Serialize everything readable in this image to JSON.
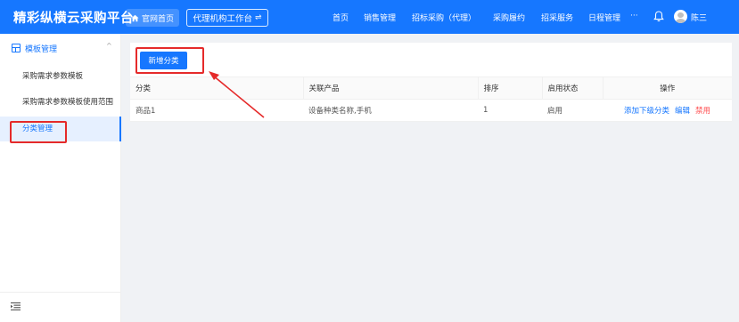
{
  "header": {
    "brand": "精彩纵横云采购平台",
    "home_button": "官网首页",
    "agent_button": "代理机构工作台",
    "agent_swap_icon": "⇌",
    "nav": [
      "首页",
      "销售管理",
      "招标采购（代理）",
      "采购履约",
      "招采服务",
      "日程管理"
    ],
    "more": "···",
    "username": "陈三"
  },
  "sidebar": {
    "group_label": "模板管理",
    "caret": "^",
    "items": [
      {
        "label": "采购需求参数模板"
      },
      {
        "label": "采购需求参数模板使用范围"
      },
      {
        "label": "分类管理"
      }
    ]
  },
  "main": {
    "add_button": "新增分类",
    "columns": [
      "分类",
      "关联产品",
      "排序",
      "启用状态",
      "操作"
    ],
    "rows": [
      {
        "category": "商品1",
        "product": "设备种类名称,手机",
        "order": "1",
        "status": "启用",
        "actions": [
          "添加下级分类",
          "编辑",
          "禁用"
        ]
      }
    ]
  },
  "colors": {
    "primary": "#1677ff",
    "danger": "#ff4d4f",
    "annotation": "#e52a2a"
  }
}
